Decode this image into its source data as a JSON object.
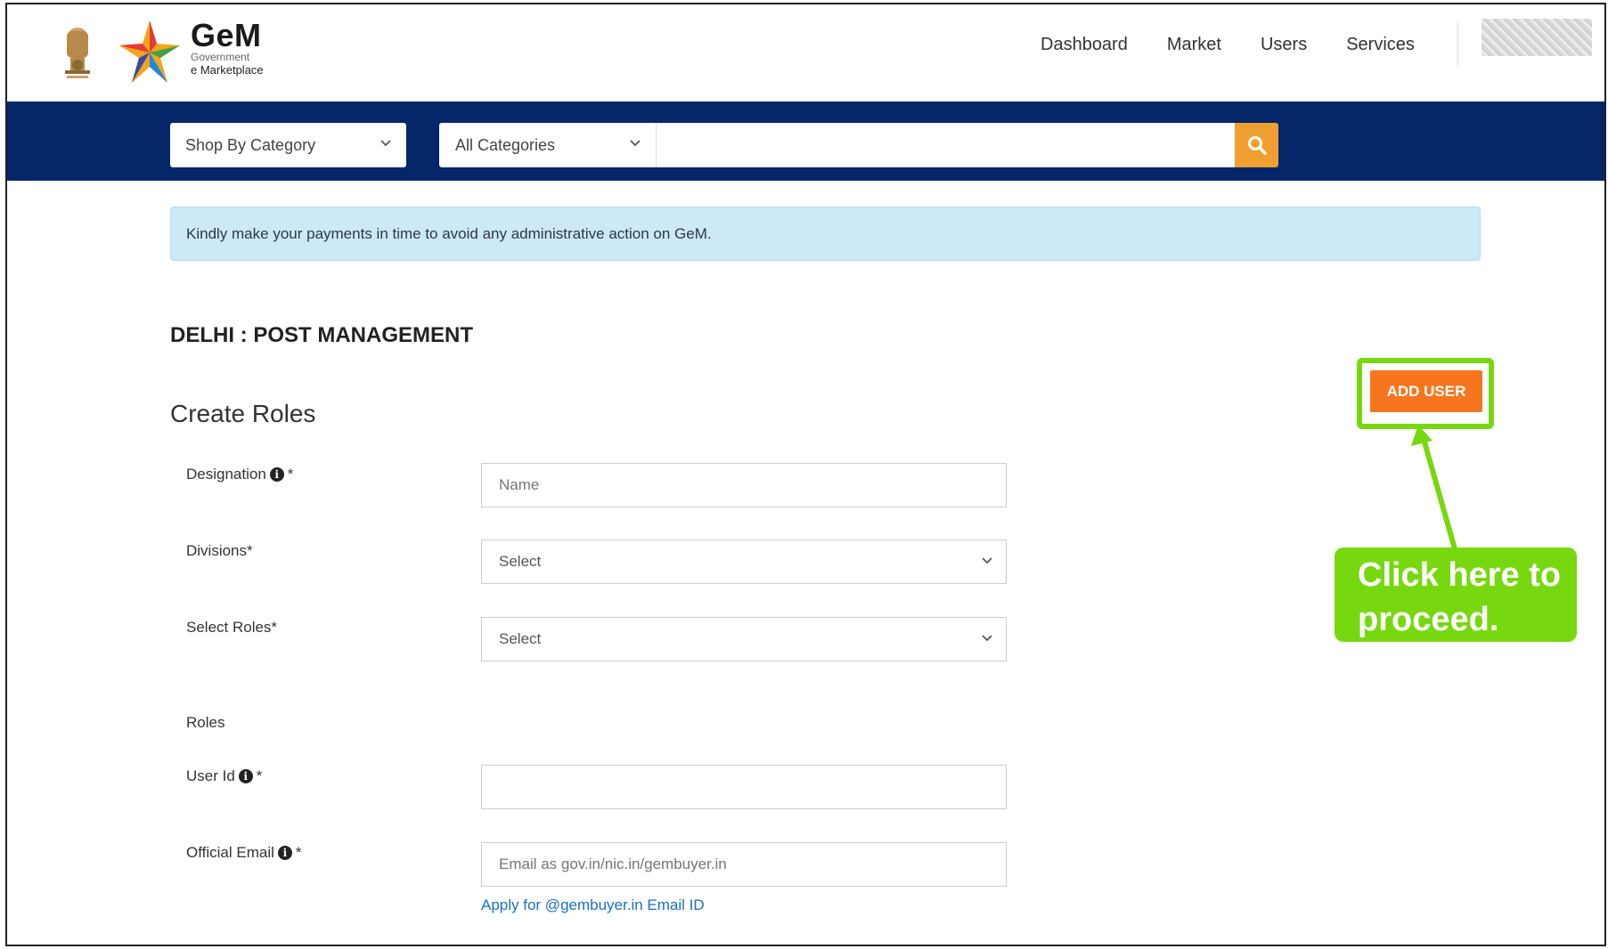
{
  "header": {
    "logo_title": "GeM",
    "logo_sub1": "Government",
    "logo_sub2": "e Marketplace",
    "nav": [
      "Dashboard",
      "Market",
      "Users",
      "Services"
    ]
  },
  "search": {
    "shop_by_category": "Shop By Category",
    "category_select": "All Categories",
    "query": ""
  },
  "alert": {
    "text": "Kindly make your payments in time to avoid any administrative action on GeM."
  },
  "page": {
    "org_title": "DELHI : POST MANAGEMENT",
    "section_title": "Create Roles",
    "add_user_label": "ADD USER"
  },
  "form": {
    "designation_label": "Designation",
    "designation_placeholder": "Name",
    "divisions_label": "Divisions*",
    "divisions_value": "Select",
    "select_roles_label": "Select Roles*",
    "select_roles_value": "Select",
    "roles_label": "Roles",
    "user_id_label": "User Id",
    "official_email_label": "Official Email",
    "official_email_placeholder": "Email as gov.in/nic.in/gembuyer.in",
    "required_mark": "*",
    "apply_link": "Apply for @gembuyer.in Email ID"
  },
  "annotation": {
    "callout_line1": "Click here to",
    "callout_line2": "proceed."
  },
  "colors": {
    "navy": "#052669",
    "search_button": "#f0a030",
    "add_user": "#f7761d",
    "callout_green": "#78d80f",
    "link_blue": "#1a6fc4"
  },
  "icons": [
    "emblem-icon",
    "gem-star-icon",
    "chevron-down-icon",
    "search-icon",
    "info-icon",
    "arrow-up-icon"
  ]
}
